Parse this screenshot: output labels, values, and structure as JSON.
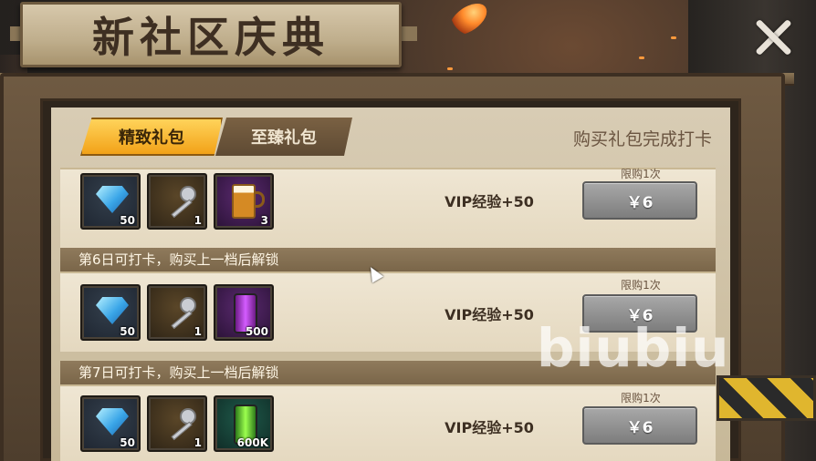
{
  "title": "新社区庆典",
  "tabs": [
    {
      "label": "精致礼包",
      "active": true
    },
    {
      "label": "至臻礼包",
      "active": false
    }
  ],
  "checkin_label": "购买礼包完成打卡",
  "rows": [
    {
      "banner": "",
      "items": [
        {
          "icon": "diamond-icon",
          "qty": "50"
        },
        {
          "icon": "key-icon",
          "qty": "1"
        },
        {
          "icon": "beer-mug-icon",
          "qty": "3"
        }
      ],
      "vip": "VIP经验+50",
      "limit": "限购1次",
      "price": "￥6"
    },
    {
      "banner": "第6日可打卡，购买上一档后解锁",
      "items": [
        {
          "icon": "diamond-icon",
          "qty": "50"
        },
        {
          "icon": "key-icon",
          "qty": "1"
        },
        {
          "icon": "purple-canister-icon",
          "qty": "500"
        }
      ],
      "vip": "VIP经验+50",
      "limit": "限购1次",
      "price": "￥6"
    },
    {
      "banner": "第7日可打卡，购买上一档后解锁",
      "items": [
        {
          "icon": "diamond-icon",
          "qty": "50"
        },
        {
          "icon": "key-icon",
          "qty": "1"
        },
        {
          "icon": "green-canister-icon",
          "qty": "600K"
        }
      ],
      "vip": "VIP经验+50",
      "limit": "限购1次",
      "price": "￥6"
    }
  ],
  "watermark": "biubiu",
  "colors": {
    "tab_active": "#f2a218",
    "price_button": "#8f8f8f",
    "panel": "#e4d8bf"
  }
}
